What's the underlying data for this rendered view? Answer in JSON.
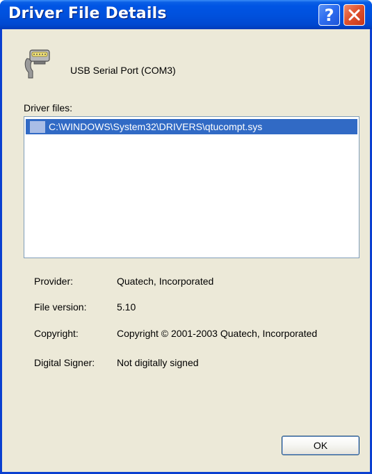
{
  "window": {
    "title": "Driver File Details",
    "help_button": "?",
    "close_button": "×"
  },
  "device": {
    "icon": "serial-port-connector-icon",
    "name": "USB Serial Port (COM3)"
  },
  "driver_files": {
    "label": "Driver files:",
    "items": [
      {
        "icon": "driver-file-icon",
        "path": "C:\\WINDOWS\\System32\\DRIVERS\\qtucompt.sys",
        "selected": true
      }
    ]
  },
  "properties": [
    {
      "label": "Provider:",
      "value": "Quatech, Incorporated"
    },
    {
      "label": "File version:",
      "value": "5.10"
    },
    {
      "label": "Copyright:",
      "value": "Copyright © 2001-2003 Quatech, Incorporated"
    },
    {
      "label": "Digital Signer:",
      "value": "Not digitally signed"
    }
  ],
  "buttons": {
    "ok": "OK"
  },
  "colors": {
    "title_bar": "#0054e3",
    "window_bg": "#ece9d8",
    "selection": "#316ac5",
    "close_button": "#e0532f"
  }
}
